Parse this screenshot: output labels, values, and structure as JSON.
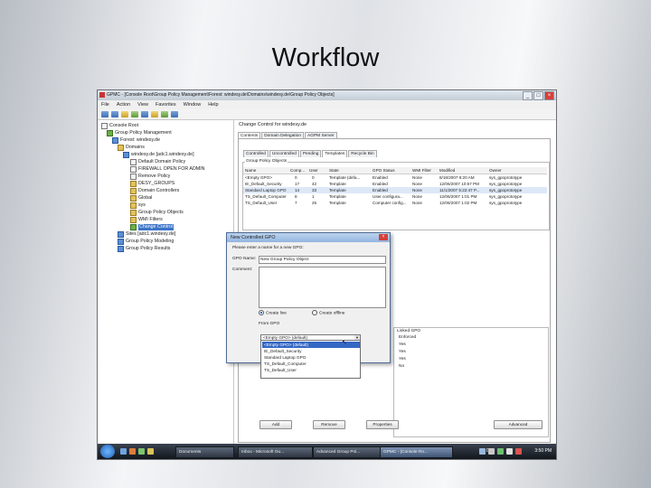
{
  "slide": {
    "title": "Workflow"
  },
  "window": {
    "title": "GPMC - [Console Root\\Group Policy Management\\Forest: windesy.de\\Domains\\windesy.de\\Group Policy Objects]",
    "menu": [
      "File",
      "Action",
      "View",
      "Favorites",
      "Window",
      "Help"
    ]
  },
  "tree": {
    "items": [
      {
        "label": "Console Root",
        "icon": "console-icon"
      },
      {
        "label": "Group Policy Management",
        "icon": "gpm-icon"
      },
      {
        "label": "Forest: windesy.de",
        "icon": "forest-icon"
      },
      {
        "label": "Domains",
        "icon": "folder-icon"
      },
      {
        "label": "windesy.de [adc1.windesy.de]",
        "icon": "domain-icon"
      },
      {
        "label": "Default Domain Policy",
        "icon": "gpo-link-icon"
      },
      {
        "label": "FIREWALL OPEN FOR ADMIN",
        "icon": "gpo-link-icon"
      },
      {
        "label": "Remove Policy",
        "icon": "gpo-link-icon"
      },
      {
        "label": "DESY_GROUPS",
        "icon": "ou-icon"
      },
      {
        "label": "Domain Controllers",
        "icon": "ou-icon"
      },
      {
        "label": "Global",
        "icon": "ou-icon"
      },
      {
        "label": "sys",
        "icon": "ou-icon"
      },
      {
        "label": "Group Policy Objects",
        "icon": "folder-icon"
      },
      {
        "label": "WMI Filters",
        "icon": "folder-icon"
      },
      {
        "label": "Change Control",
        "icon": "change-control-icon"
      },
      {
        "label": "Sites [adc1.windesy.de]",
        "icon": "sites-icon"
      },
      {
        "label": "Group Policy Modeling",
        "icon": "modeling-icon"
      },
      {
        "label": "Group Policy Results",
        "icon": "results-icon"
      }
    ]
  },
  "right": {
    "title": "Change Control for windesy.de",
    "tabs": [
      "Contents",
      "Domain Delegation",
      "AGPM Server"
    ],
    "subtabs": [
      "Controlled",
      "Uncontrolled",
      "Pending",
      "Templates",
      "Recycle Bin"
    ],
    "objects_label": "Group Policy Objects",
    "columns": [
      "Name",
      "Comp...",
      "User",
      "State",
      "GPO Status",
      "WMI Filter",
      "Modified",
      "Owner"
    ],
    "rows": [
      [
        "<Empty GPO>",
        "0",
        "0",
        "Template (defa...",
        "Enabled",
        "None",
        "8/18/2007 6:20 AM",
        "sys_gpoprototype"
      ],
      [
        "IE_Default_Security",
        "17",
        "42",
        "Template",
        "Enabled",
        "None",
        "12/06/2007 10:57 PM",
        "sys_gpoprototype"
      ],
      [
        "Standard Laptop GPO",
        "14",
        "33",
        "Template",
        "Enabled",
        "None",
        "11/1/2007 5:22:47 P...",
        "sys_gpoprototype"
      ],
      [
        "TS_Default_Computer",
        "8",
        "1",
        "Template",
        "User configura...",
        "None",
        "12/06/2007 1:01 PM",
        "sys_gpoprototype"
      ],
      [
        "TS_Default_User",
        "7",
        "25",
        "Template",
        "Computer config...",
        "None",
        "12/06/2007 1:02 PM",
        "sys_gpoprototype"
      ]
    ],
    "linked_label": "Linked GPO",
    "enforced_header": "Enforced",
    "enforced_values": [
      "Yes",
      "Yes",
      "Yes",
      "No"
    ],
    "buttons": [
      "Add",
      "Remove",
      "Properties",
      "Advanced"
    ]
  },
  "dialog": {
    "title": "New Controlled GPO",
    "prompt": "Please enter a name for a new GPO:",
    "name_label": "GPO Name:",
    "name_value": "New Group Policy Object",
    "comment_label": "Comment:",
    "radio_create_live": "Create live",
    "radio_create_offline": "Create offline",
    "from_label": "From GPO",
    "selected": "<Empty GPO> (default)",
    "options": [
      "<Empty GPO> (default)",
      "IE_Default_Security",
      "Standard Laptop GPO",
      "TS_Default_Computer",
      "TS_Default_User"
    ],
    "partial_item": "TS_Default_User"
  },
  "taskbar": {
    "tasks": [
      "Documents",
      "Inbox - Microsoft Ou...",
      "Advanced Group Pol...",
      "GPMC - [Console Ro..."
    ],
    "lang": "DE",
    "clock": "3:50 PM"
  }
}
